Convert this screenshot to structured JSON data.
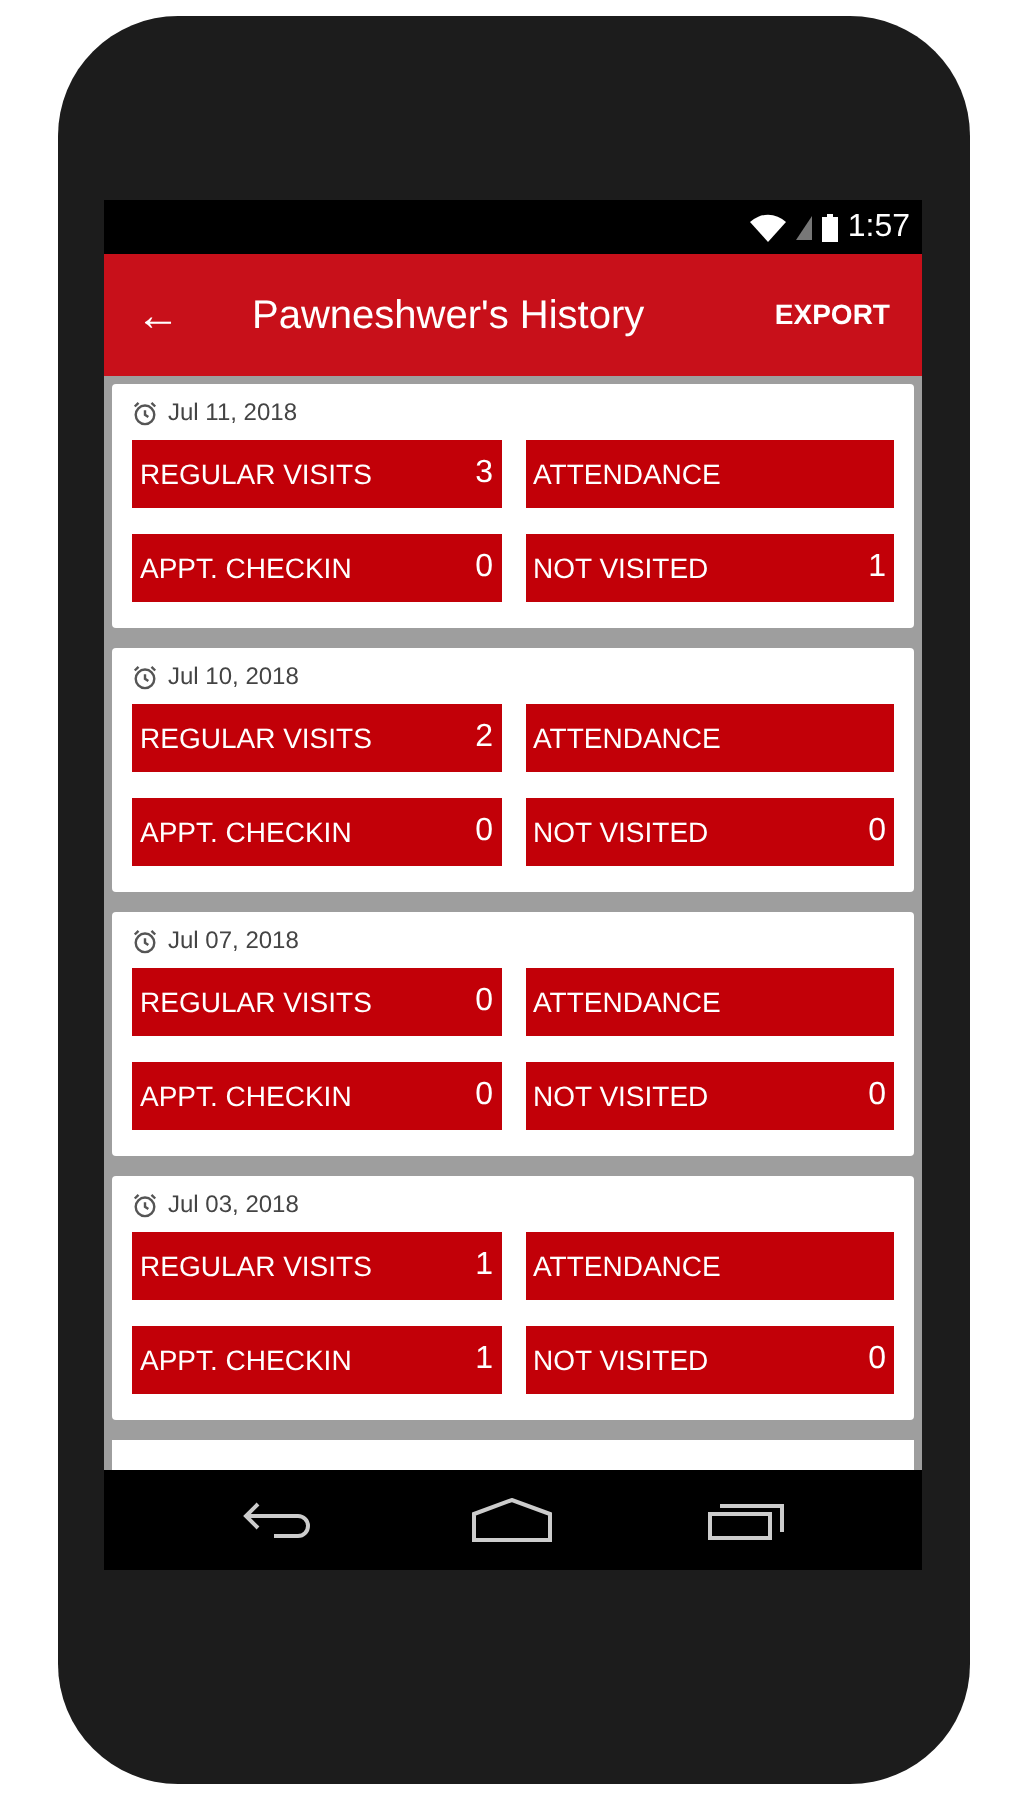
{
  "status_bar": {
    "time": "1:57"
  },
  "app_bar": {
    "back": "←",
    "title": "Pawneshwer's History",
    "action": "EXPORT"
  },
  "cards": [
    {
      "date": "Jul 11, 2018",
      "tiles": [
        {
          "label": "REGULAR VISITS",
          "value": "3"
        },
        {
          "label": "ATTENDANCE"
        },
        {
          "label": "APPT. CHECKIN",
          "value": "0"
        },
        {
          "label": "NOT VISITED",
          "value": "1"
        }
      ]
    },
    {
      "date": "Jul 10, 2018",
      "tiles": [
        {
          "label": "REGULAR VISITS",
          "value": "2"
        },
        {
          "label": "ATTENDANCE"
        },
        {
          "label": "APPT. CHECKIN",
          "value": "0"
        },
        {
          "label": "NOT VISITED",
          "value": "0"
        }
      ]
    },
    {
      "date": "Jul 07, 2018",
      "tiles": [
        {
          "label": "REGULAR VISITS",
          "value": "0"
        },
        {
          "label": "ATTENDANCE"
        },
        {
          "label": "APPT. CHECKIN",
          "value": "0"
        },
        {
          "label": "NOT VISITED",
          "value": "0"
        }
      ]
    },
    {
      "date": "Jul 03, 2018",
      "tiles": [
        {
          "label": "REGULAR VISITS",
          "value": "1"
        },
        {
          "label": "ATTENDANCE"
        },
        {
          "label": "APPT. CHECKIN",
          "value": "1"
        },
        {
          "label": "NOT VISITED",
          "value": "0"
        }
      ]
    }
  ]
}
